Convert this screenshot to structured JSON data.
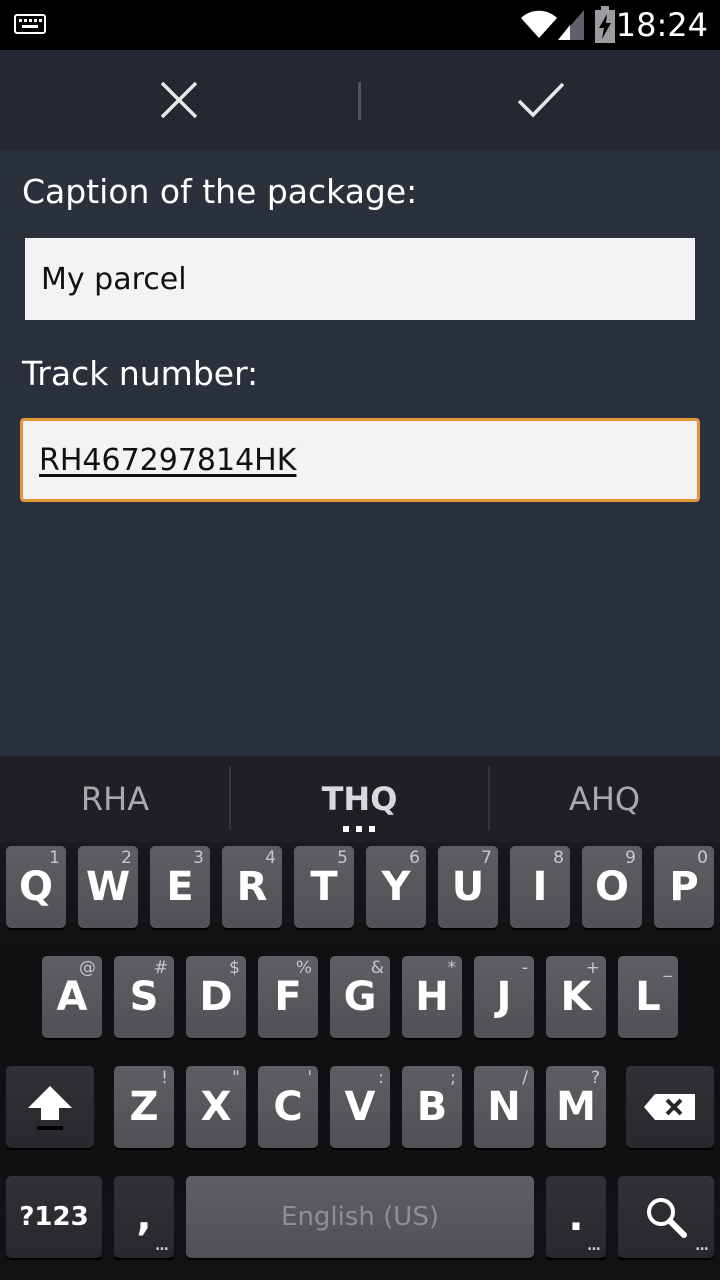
{
  "status_bar": {
    "time": "18:24",
    "icons": [
      "keyboard-icon",
      "wifi-icon",
      "signal-icon",
      "battery-charging-icon"
    ]
  },
  "action_bar": {
    "cancel_icon": "close-icon",
    "confirm_icon": "check-icon"
  },
  "form": {
    "caption_label": "Caption of the package:",
    "caption_value": "My parcel",
    "track_label": "Track number:",
    "track_value": "RH467297814HK"
  },
  "colors": {
    "background": "#2b313c",
    "action_bar": "#232831",
    "focus_border": "#e4953a"
  },
  "keyboard": {
    "suggestions": [
      "RHA",
      "THQ",
      "AHQ"
    ],
    "row1": [
      {
        "label": "Q",
        "hint": "1"
      },
      {
        "label": "W",
        "hint": "2"
      },
      {
        "label": "E",
        "hint": "3"
      },
      {
        "label": "R",
        "hint": "4"
      },
      {
        "label": "T",
        "hint": "5"
      },
      {
        "label": "Y",
        "hint": "6"
      },
      {
        "label": "U",
        "hint": "7"
      },
      {
        "label": "I",
        "hint": "8"
      },
      {
        "label": "O",
        "hint": "9"
      },
      {
        "label": "P",
        "hint": "0"
      }
    ],
    "row2": [
      {
        "label": "A",
        "hint": "@"
      },
      {
        "label": "S",
        "hint": "#"
      },
      {
        "label": "D",
        "hint": "$"
      },
      {
        "label": "F",
        "hint": "%"
      },
      {
        "label": "G",
        "hint": "&"
      },
      {
        "label": "H",
        "hint": "*"
      },
      {
        "label": "J",
        "hint": "-"
      },
      {
        "label": "K",
        "hint": "+"
      },
      {
        "label": "L",
        "hint": "_"
      }
    ],
    "row3": [
      {
        "label": "Z",
        "hint": "!"
      },
      {
        "label": "X",
        "hint": "\""
      },
      {
        "label": "C",
        "hint": "'"
      },
      {
        "label": "V",
        "hint": ":"
      },
      {
        "label": "B",
        "hint": ";"
      },
      {
        "label": "N",
        "hint": "/"
      },
      {
        "label": "M",
        "hint": "?"
      }
    ],
    "symbols_label": "?123",
    "comma_label": ",",
    "space_label": "English (US)",
    "period_label": ".",
    "shift_icon": "shift-icon",
    "backspace_icon": "backspace-icon",
    "search_icon": "search-icon"
  }
}
